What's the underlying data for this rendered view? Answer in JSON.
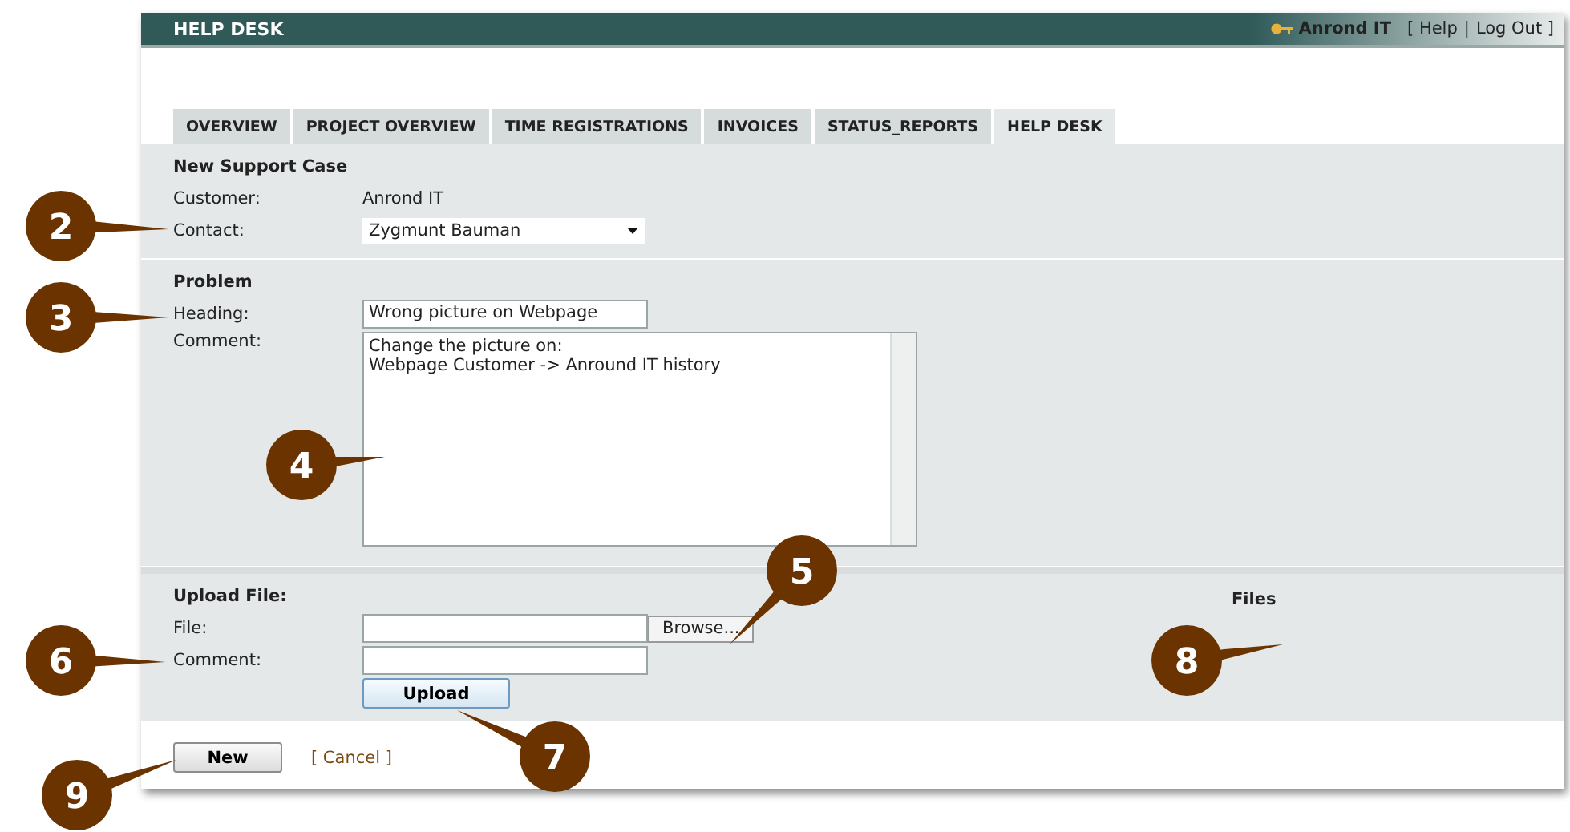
{
  "header": {
    "title": "HELP DESK",
    "user": "Anrond IT",
    "links": [
      {
        "label": "[ Help"
      },
      {
        "label": "|"
      },
      {
        "label": "Log Out ]"
      }
    ]
  },
  "tabs": [
    {
      "label": "OVERVIEW",
      "selected": false
    },
    {
      "label": "PROJECT OVERVIEW",
      "selected": false
    },
    {
      "label": "TIME REGISTRATIONS",
      "selected": false
    },
    {
      "label": "INVOICES",
      "selected": false
    },
    {
      "label": "STATUS_REPORTS",
      "selected": false
    },
    {
      "label": "HELP DESK",
      "selected": true
    }
  ],
  "support_case": {
    "title": "New Support Case",
    "customer_label": "Customer:",
    "customer": "Anrond IT",
    "contact_label": "Contact:",
    "contact": "Zygmunt Bauman"
  },
  "problem": {
    "title": "Problem",
    "heading_label": "Heading:",
    "heading": "Wrong picture on Webpage",
    "comment_label": "Comment:",
    "comment": "Change the picture on:\nWebpage Customer -> Anround IT history"
  },
  "upload": {
    "title": "Upload File:",
    "file_label": "File:",
    "browse": "Browse...",
    "comment_label": "Comment:",
    "upload_button": "Upload",
    "files_title": "Files"
  },
  "actions": {
    "new_button": "New",
    "cancel": "[ Cancel ]"
  },
  "callouts": [
    {
      "number": "2"
    },
    {
      "number": "3"
    },
    {
      "number": "4"
    },
    {
      "number": "5"
    },
    {
      "number": "6"
    },
    {
      "number": "7"
    },
    {
      "number": "8"
    },
    {
      "number": "9"
    }
  ]
}
